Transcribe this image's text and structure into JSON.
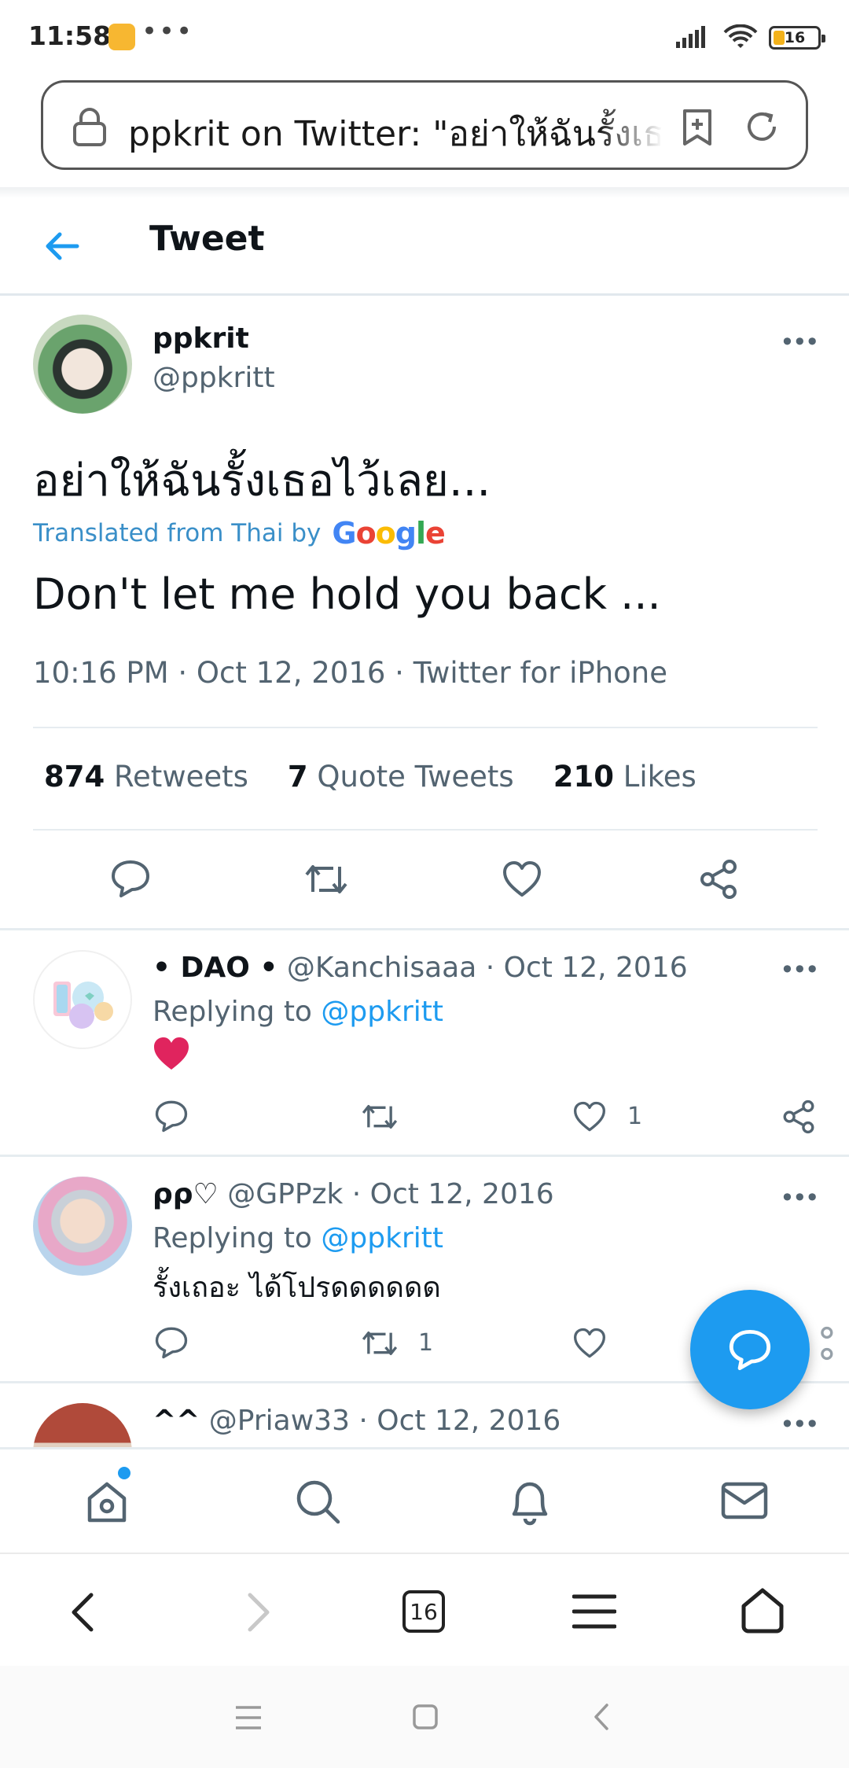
{
  "status_bar": {
    "time": "11:58",
    "dots": "•••",
    "battery": "16"
  },
  "url_bar": {
    "text": "ppkrit on Twitter: \"อย่าให้ฉันรั้งเธอไว้เลย...\""
  },
  "header": {
    "title": "Tweet"
  },
  "tweet": {
    "name": "ppkrit",
    "handle": "@ppkritt",
    "text": "อย่าให้ฉันรั้งเธอไว้เลย...",
    "translated_label": "Translated from Thai by",
    "translated_brand": "Google",
    "translation": "Don't let me hold you back ...",
    "meta": "10:16 PM · Oct 12, 2016 · Twitter for iPhone",
    "stats": {
      "retweets_count": "874",
      "retweets_label": "Retweets",
      "quotes_count": "7",
      "quotes_label": "Quote Tweets",
      "likes_count": "210",
      "likes_label": "Likes"
    }
  },
  "replies": [
    {
      "name": "• DAO •",
      "handle_date": "@Kanchisaaa · Oct 12, 2016",
      "replying_label": "Replying to",
      "replying_handle": "@ppkritt",
      "body": "❤",
      "like_count": "1",
      "retweet_count": ""
    },
    {
      "name": "ρρ♡",
      "handle_date": "@GPPzk · Oct 12, 2016",
      "replying_label": "Replying to",
      "replying_handle": "@ppkritt",
      "body": "รั้งเถอะ ได้โปรดดดดดด",
      "like_count": "",
      "retweet_count": "1"
    },
    {
      "name": "^^",
      "handle_date": "@Priaw33 · Oct 12, 2016"
    }
  ],
  "more_icon": "•••",
  "browser_nav": {
    "tabs_count": "16"
  },
  "colors": {
    "twitter_blue": "#1d9bf0",
    "text_secondary": "#536471",
    "heart_red": "#e0245e"
  }
}
